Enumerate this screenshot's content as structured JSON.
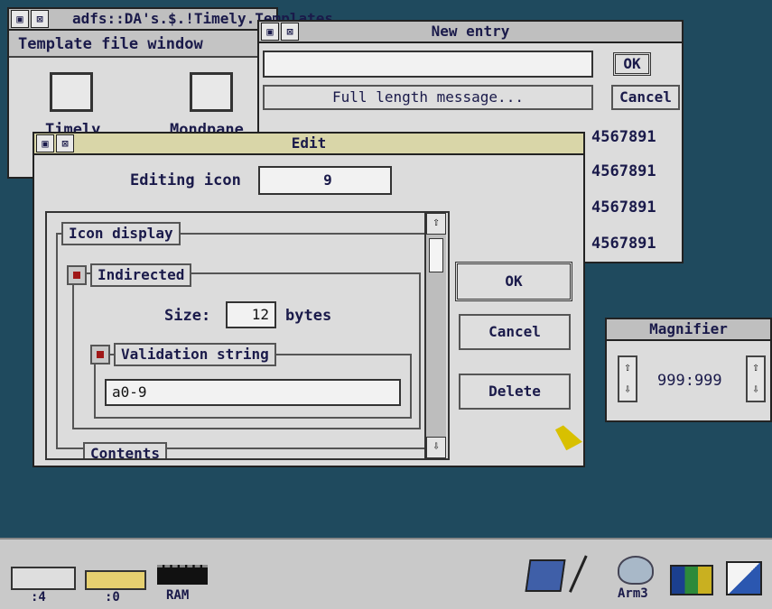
{
  "desktop": {
    "background": "#1f4a5e"
  },
  "template_window": {
    "title": "adfs::DA's.$.!Timely.Templates",
    "subtitle": "Template file window",
    "icons": [
      {
        "label": "Timely"
      },
      {
        "label": "Mondpane"
      }
    ]
  },
  "new_entry_window": {
    "title": "New entry",
    "input_value": "",
    "message_button": "Full length message...",
    "ok": "OK",
    "cancel": "Cancel",
    "rows": [
      "4567891",
      "4567891",
      "4567891",
      "4567891"
    ],
    "partial_number": "01234567891"
  },
  "edit_window": {
    "title": "Edit",
    "editing_icon_label": "Editing icon",
    "editing_icon_value": "9",
    "icon_display_label": "Icon display",
    "indirected_label": "Indirected",
    "size_label": "Size:",
    "size_value": "12",
    "size_unit": "bytes",
    "validation_label": "Validation string",
    "validation_value": "a0-9",
    "contents_label": "Contents",
    "ok": "OK",
    "cancel": "Cancel",
    "delete": "Delete"
  },
  "magnifier_window": {
    "title": "Magnifier",
    "value": "999:999"
  },
  "iconbar": {
    "items": [
      {
        "label": ":4",
        "icon": "floppy-drive-icon"
      },
      {
        "label": ":0",
        "icon": "hard-drive-icon"
      },
      {
        "label": "RAM",
        "icon": "ram-disc-icon"
      },
      {
        "label": "",
        "icon": "paint-icon"
      },
      {
        "label": "",
        "icon": "edit-quill-icon"
      },
      {
        "label": "Arm3",
        "icon": "arm3-rabbit-icon"
      },
      {
        "label": "",
        "icon": "palette-icon"
      },
      {
        "label": "",
        "icon": "task-manager-icon"
      }
    ]
  }
}
